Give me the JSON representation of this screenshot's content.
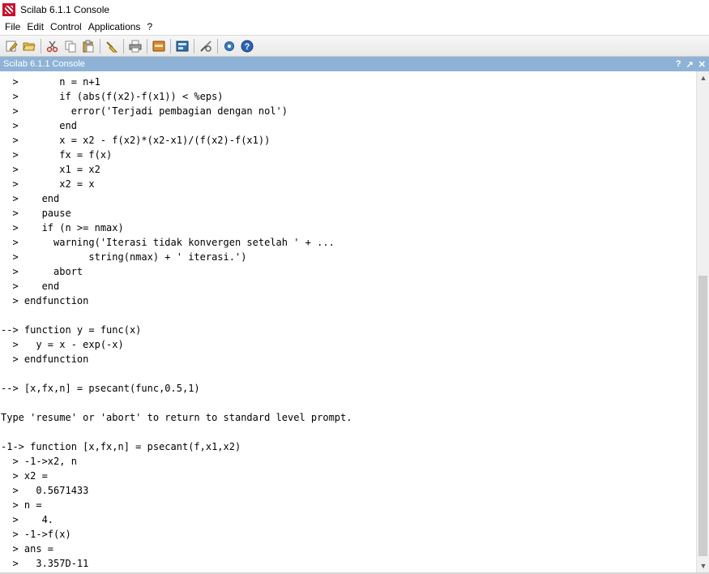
{
  "window": {
    "title": "Scilab 6.1.1 Console"
  },
  "menu": [
    "File",
    "Edit",
    "Control",
    "Applications",
    "?"
  ],
  "toolbar": {
    "icons": [
      "new-script-icon",
      "open-file-icon",
      "cut-icon",
      "copy-icon",
      "paste-icon",
      "clear-console-icon",
      "print-icon",
      "module-manager-icon",
      "variable-browser-icon",
      "demos-icon",
      "settings-icon",
      "help-icon"
    ]
  },
  "panel": {
    "title": "Scilab 6.1.1 Console",
    "controls": [
      "?",
      "↗",
      "✕"
    ]
  },
  "console": {
    "lines": [
      "  >       n = n+1",
      "  >       if (abs(f(x2)-f(x1)) < %eps)",
      "  >         error('Terjadi pembagian dengan nol')",
      "  >       end",
      "  >       x = x2 - f(x2)*(x2-x1)/(f(x2)-f(x1))",
      "  >       fx = f(x)",
      "  >       x1 = x2",
      "  >       x2 = x",
      "  >    end",
      "  >    pause",
      "  >    if (n >= nmax)",
      "  >      warning('Iterasi tidak konvergen setelah ' + ...",
      "  >            string(nmax) + ' iterasi.')",
      "  >      abort",
      "  >    end",
      "  > endfunction",
      "",
      "--> function y = func(x)",
      "  >   y = x - exp(-x)",
      "  > endfunction",
      "",
      "--> [x,fx,n] = psecant(func,0.5,1)",
      "",
      "Type 'resume' or 'abort' to return to standard level prompt.",
      "",
      "-1-> function [x,fx,n] = psecant(f,x1,x2)",
      "  > -1->x2, n",
      "  > x2 =",
      "  >   0.5671433",
      "  > n =",
      "  >    4.",
      "  > -1->f(x)",
      "  > ans =",
      "  >   3.357D-11"
    ]
  },
  "colors": {
    "panel_header": "#8fb3d6",
    "toolbar_bg": "#ececec",
    "scrollbar_thumb": "#cdcdcd"
  }
}
